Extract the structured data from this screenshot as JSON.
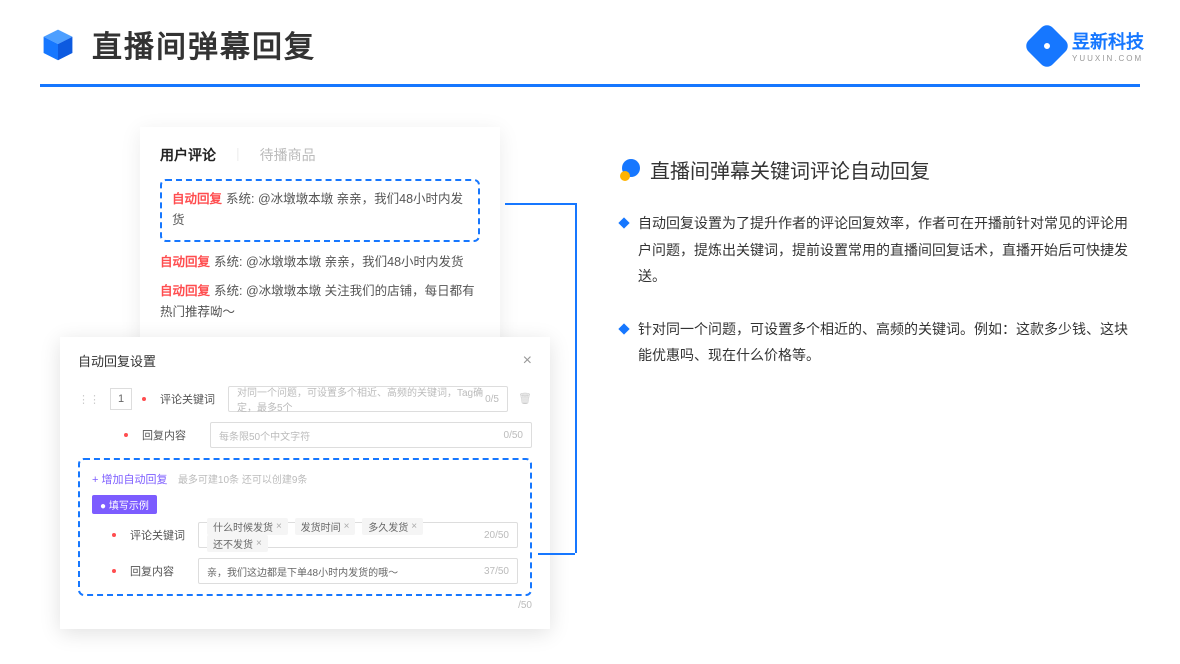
{
  "header": {
    "title": "直播间弹幕回复"
  },
  "brand": {
    "name": "昱新科技",
    "sub": "YUUXIN.COM"
  },
  "comments_panel": {
    "tabs": {
      "active": "用户评论",
      "inactive": "待播商品"
    },
    "highlighted": {
      "badge": "自动回复",
      "text": "系统: @冰墩墩本墩 亲亲，我们48小时内发货"
    },
    "rows": [
      {
        "badge": "自动回复",
        "text": "系统: @冰墩墩本墩 亲亲，我们48小时内发货"
      },
      {
        "badge": "自动回复",
        "text": "系统: @冰墩墩本墩 关注我们的店铺，每日都有热门推荐呦～"
      }
    ]
  },
  "settings_panel": {
    "title": "自动回复设置",
    "close": "×",
    "index": "1",
    "keyword_label": "评论关键词",
    "keyword_placeholder": "对同一个问题，可设置多个相近、高频的关键词，Tag确定，最多5个",
    "keyword_count": "0/5",
    "content_label": "回复内容",
    "content_placeholder": "每条限50个中文字符",
    "content_count": "0/50",
    "add_link": "+ 增加自动回复",
    "add_hint": "最多可建10条 还可以创建9条",
    "example_badge": "● 填写示例",
    "ex_keyword_label": "评论关键词",
    "ex_tags": [
      "什么时候发货",
      "发货时间",
      "多久发货",
      "还不发货"
    ],
    "ex_keyword_count": "20/50",
    "ex_content_label": "回复内容",
    "ex_content_value": "亲，我们这边都是下单48小时内发货的哦～",
    "ex_content_count": "37/50",
    "outer_count": "/50"
  },
  "right": {
    "section_title": "直播间弹幕关键词评论自动回复",
    "bullets": [
      "自动回复设置为了提升作者的评论回复效率，作者可在开播前针对常见的评论用户问题，提炼出关键词，提前设置常用的直播间回复话术，直播开始后可快捷发送。",
      "针对同一个问题，可设置多个相近的、高频的关键词。例如：这款多少钱、这块能优惠吗、现在什么价格等。"
    ]
  }
}
